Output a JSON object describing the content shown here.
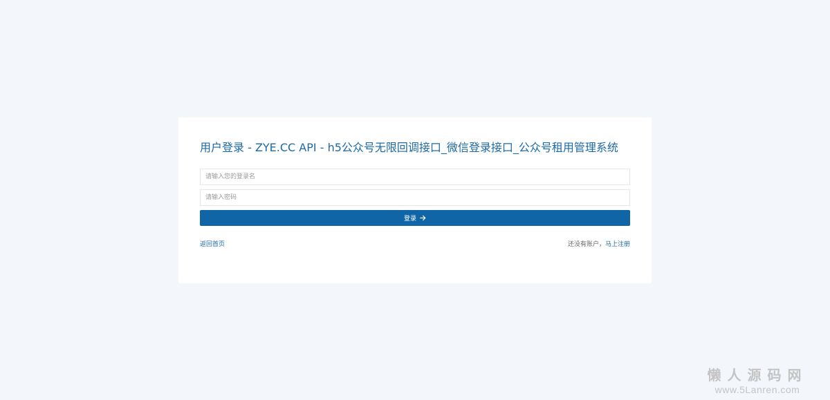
{
  "login": {
    "title": "用户登录 - ZYE.CC API - h5公众号无限回调接口_微信登录接口_公众号租用管理系统",
    "username_placeholder": "请输入您的登录名",
    "password_placeholder": "请输入密码",
    "submit_label": "登录",
    "submit_icon": "arrow-right-icon",
    "home_link": "返回首页",
    "no_account_text": "还没有账户，",
    "register_link": "马上注册"
  },
  "watermark": {
    "title": "懒人源码网",
    "url": "www.5Lanren.com"
  },
  "colors": {
    "background": "#f3f6fb",
    "card": "#ffffff",
    "accent": "#1065a6",
    "title": "#1c69a8",
    "muted_text": "#666666"
  }
}
